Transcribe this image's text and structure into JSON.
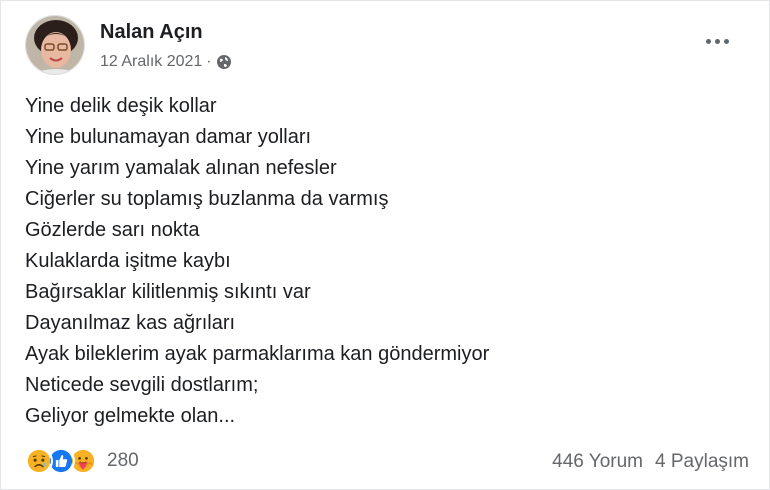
{
  "post": {
    "author": "Nalan Açın",
    "date": "12 Aralık 2021",
    "separator": "·",
    "privacy_icon": "globe-icon",
    "more_icon": "more-options-icon",
    "lines": [
      "Yine delik deşik kollar",
      "Yine bulunamayan damar yolları",
      "Yine yarım yamalak alınan nefesler",
      "Ciğerler su toplamış buzlanma da varmış",
      "Gözlerde sarı nokta",
      "Kulaklarda işitme kaybı",
      "Bağırsaklar kilitlenmiş sıkıntı var",
      "Dayanılmaz kas ağrıları",
      "Ayak bileklerim ayak parmaklarıma kan göndermiyor",
      "Neticede sevgili dostlarım;",
      "Geliyor gelmekte olan..."
    ],
    "reactions": {
      "icons": [
        "sad-reaction-icon",
        "like-reaction-icon",
        "care-reaction-icon"
      ],
      "count": "280"
    },
    "comments": "446 Yorum",
    "shares": "4 Paylaşım"
  },
  "colors": {
    "text": "#1c1e21",
    "muted": "#65676b",
    "like_blue": "#1877f2",
    "reaction_yellow": "#f7b125"
  }
}
